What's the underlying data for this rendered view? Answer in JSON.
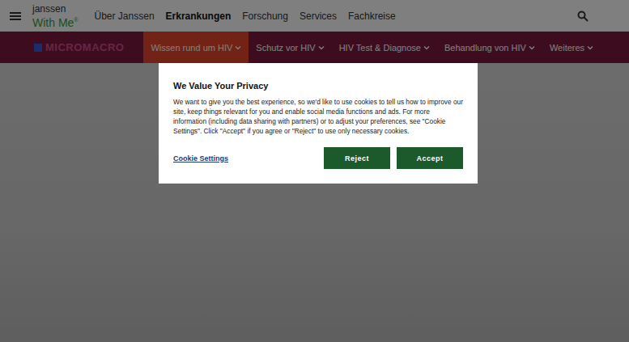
{
  "header": {
    "logo": {
      "top": "janssen",
      "bottom": "With Me",
      "mark": "®"
    },
    "nav": [
      {
        "label": "Über Janssen",
        "selected": false
      },
      {
        "label": "Erkrankungen",
        "selected": true
      },
      {
        "label": "Forschung",
        "selected": false
      },
      {
        "label": "Services",
        "selected": false
      },
      {
        "label": "Fachkreise",
        "selected": false
      }
    ]
  },
  "subnav": {
    "logo": "MICROMACRO",
    "items": [
      {
        "label": "Wissen rund um HIV",
        "selected": true
      },
      {
        "label": "Schutz vor HIV",
        "selected": false
      },
      {
        "label": "HIV Test & Diagnose",
        "selected": false
      },
      {
        "label": "Behandlung von HIV",
        "selected": false
      },
      {
        "label": "Weiteres",
        "selected": false
      }
    ]
  },
  "dialog": {
    "title": "We Value Your Privacy",
    "body": "We want to give you the best experience, so we'd like to use cookies to tell us how to improve our site, keep things relevant for you and enable social media functions and ads. For more information (including data sharing with partners) or to adjust your preferences, see \"Cookie Settings\". Click \"Accept\" if you agree or \"Reject\" to use only necessary cookies.",
    "link": "Cookie Settings",
    "buttons": [
      "Reject",
      "Accept"
    ]
  }
}
